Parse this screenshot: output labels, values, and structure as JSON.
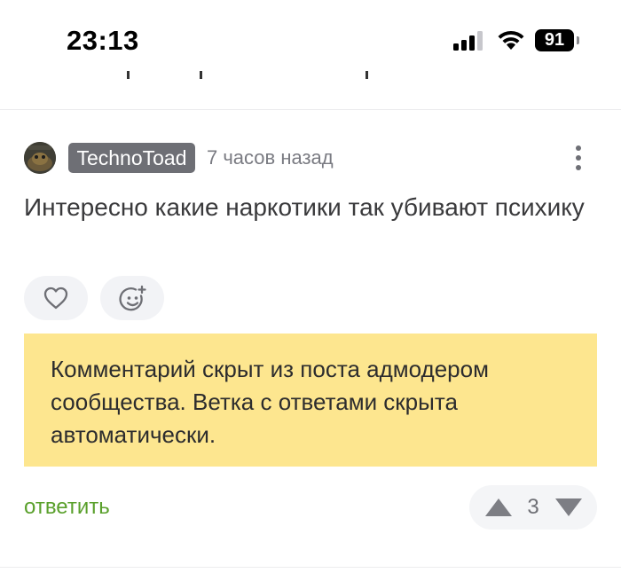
{
  "status_bar": {
    "time": "23:13",
    "battery_level": "91",
    "signal_icon": "signal-bars-icon",
    "wifi_icon": "wifi-icon"
  },
  "comment": {
    "username": "TechnoToad",
    "timestamp": "7 часов назад",
    "text": "Интересно какие наркотики так убивают психику",
    "more_icon": "more-vertical-icon",
    "like_icon": "heart-icon",
    "reaction_icon": "add-emoji-icon",
    "hidden_notice": "Комментарий скрыт из поста адмодером сообщества. Ветка с ответами скрыта автоматически.",
    "reply_label": "ответить",
    "rating": "3",
    "upvote_icon": "triangle-up-icon",
    "downvote_icon": "triangle-down-icon"
  },
  "colors": {
    "notice_background": "#fde68f",
    "reply_link": "#5aa02c",
    "username_badge": "#6e6f75"
  }
}
